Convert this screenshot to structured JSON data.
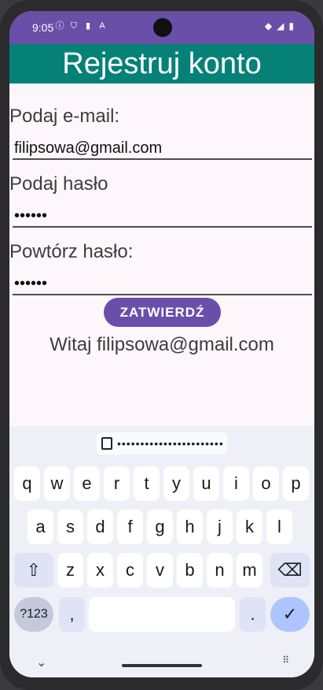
{
  "status_bar": {
    "time": "9:05",
    "left_icons": [
      "info-icon",
      "shield-icon",
      "sd-card-icon",
      "a-icon"
    ],
    "right_icons": [
      "wifi-icon",
      "signal-icon",
      "battery-icon"
    ]
  },
  "app_bar": {
    "title": "Rejestruj konto"
  },
  "form": {
    "email_label": "Podaj e-mail:",
    "email_value": "filipsowa@gmail.com",
    "password_label": "Podaj hasło",
    "password_value": "••••••",
    "repeat_label": "Powtórz hasło:",
    "repeat_value": "••••••",
    "confirm_button": "ZATWIERDŹ",
    "welcome_text": "Witaj filipsowa@gmail.com"
  },
  "keyboard": {
    "suggestion": "•••••••••••••••••••••••",
    "row1": [
      "q",
      "w",
      "e",
      "r",
      "t",
      "y",
      "u",
      "i",
      "o",
      "p"
    ],
    "row2": [
      "a",
      "s",
      "d",
      "f",
      "g",
      "h",
      "j",
      "k",
      "l"
    ],
    "row3": [
      "z",
      "x",
      "c",
      "v",
      "b",
      "n",
      "m"
    ],
    "symbols_key": "?123",
    "comma_key": ",",
    "period_key": ".",
    "shift_icon": "shift-icon",
    "backspace_icon": "backspace-icon",
    "enter_icon": "check-icon"
  },
  "nav": {
    "down_icon": "chevron-down-icon",
    "keyboard_icon": "keyboard-grid-icon"
  }
}
